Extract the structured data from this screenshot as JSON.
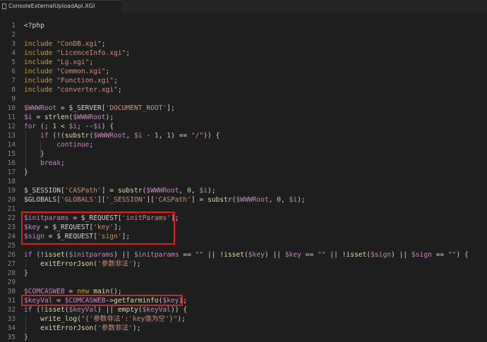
{
  "tab": {
    "title": "ConsoleExternalUploadApi.XGI"
  },
  "colors": {
    "highlight": "#e02020",
    "background": "#1e1e1e"
  },
  "lines": [
    {
      "n": "1",
      "t": "<?php"
    },
    {
      "n": "2",
      "t": ""
    },
    {
      "n": "3",
      "t": "include \"ConDB.xgi\";"
    },
    {
      "n": "4",
      "t": "include \"LicenceInfo.xgi\";"
    },
    {
      "n": "5",
      "t": "include \"Lg.xgi\";"
    },
    {
      "n": "6",
      "t": "include \"Common.xgi\";"
    },
    {
      "n": "7",
      "t": "include \"Function.xgi\";"
    },
    {
      "n": "8",
      "t": "include \"converter.xgi\";"
    },
    {
      "n": "9",
      "t": ""
    },
    {
      "n": "10",
      "t": "$WWWRoot = $_SERVER['DOCUMENT_ROOT'];"
    },
    {
      "n": "11",
      "t": "$i = strlen($WWWRoot);"
    },
    {
      "n": "12",
      "t": "for (; 1 < $i; --$i) {"
    },
    {
      "n": "13",
      "t": "    if (!(substr($WWWRoot, $i - 1, 1) == \"/\")) {"
    },
    {
      "n": "14",
      "t": "        continue;"
    },
    {
      "n": "15",
      "t": "    }"
    },
    {
      "n": "16",
      "t": "    break;"
    },
    {
      "n": "17",
      "t": "}"
    },
    {
      "n": "18",
      "t": ""
    },
    {
      "n": "19",
      "t": "$_SESSION['CASPath'] = substr($WWWRoot, 0, $i);"
    },
    {
      "n": "20",
      "t": "$GLOBALS['GLOBALS']['_SESSION']['CASPath'] = substr($WWWRoot, 0, $i);"
    },
    {
      "n": "21",
      "t": ""
    },
    {
      "n": "22",
      "t": "$initparams = $_REQUEST['initParams'];"
    },
    {
      "n": "23",
      "t": "$key = $_REQUEST['key'];"
    },
    {
      "n": "24",
      "t": "$sign = $_REQUEST['sign'];"
    },
    {
      "n": "25",
      "t": ""
    },
    {
      "n": "26",
      "t": "if (!isset($initparams) || $initparams == \"\" || !isset($key) || $key == \"\" || !isset($sign) || $sign == \"\") {"
    },
    {
      "n": "27",
      "t": "    exitErrorJson('参数非法');"
    },
    {
      "n": "28",
      "t": "}"
    },
    {
      "n": "29",
      "t": ""
    },
    {
      "n": "30",
      "t": "$COMCASWEB = new main();"
    },
    {
      "n": "31",
      "t": "$keyVal = $COMCASWEB->getfarminfo($key);"
    },
    {
      "n": "32",
      "t": "if (!isset($keyVal) || empty($keyVal)) {"
    },
    {
      "n": "33",
      "t": "    write_log(\"{'参数非法':'key值为空'}\");"
    },
    {
      "n": "34",
      "t": "    exitErrorJson('参数非法');"
    },
    {
      "n": "35",
      "t": "}"
    }
  ]
}
